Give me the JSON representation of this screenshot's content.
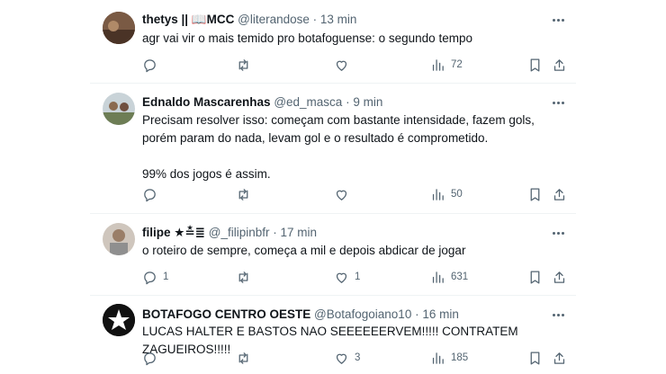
{
  "tweets": [
    {
      "name": "thetys || 📖MCC",
      "handle": "@literandose",
      "time": "13 min",
      "text": "agr vai vir o mais temido pro botafoguense: o segundo tempo",
      "replies": "",
      "retweets": "",
      "likes": "",
      "views": "72",
      "avatar_color": "#6b4a3a"
    },
    {
      "name": "Ednaldo Mascarenhas",
      "handle": "@ed_masca",
      "time": "9 min",
      "text": "Precisam resolver isso: começam com bastante intensidade, fazem gols,\nporém param do nada, levam gol e o resultado é comprometido.\n\n99% dos jogos é assim.",
      "replies": "",
      "retweets": "",
      "likes": "",
      "views": "50",
      "avatar_color": "#7a8a6a"
    },
    {
      "name": "filipe ★≛≣",
      "handle": "@_filipinbfr",
      "time": "17 min",
      "text": "o roteiro de sempre, começa a mil e depois abdicar de jogar",
      "replies": "1",
      "retweets": "",
      "likes": "1",
      "views": "631",
      "avatar_color": "#a89888"
    },
    {
      "name": "BOTAFOGO CENTRO OESTE",
      "handle": "@Botafogoiano10",
      "time": "16 min",
      "text": "LUCAS HALTER E BASTOS NAO SEEEEEERVEM!!!!! CONTRATEM ZAGUEIROS!!!!!",
      "replies": "",
      "retweets": "",
      "likes": "3",
      "views": "185",
      "avatar_color": "#111111"
    }
  ]
}
